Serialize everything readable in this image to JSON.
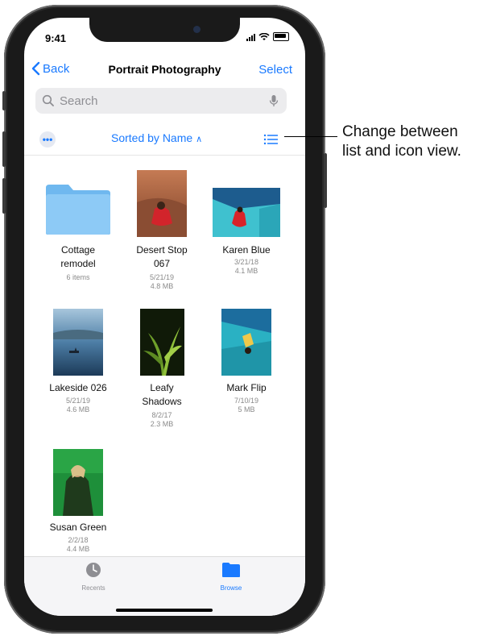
{
  "status_bar": {
    "time": "9:41"
  },
  "nav": {
    "back_label": "Back",
    "title": "Portrait Photography",
    "select_label": "Select"
  },
  "search": {
    "placeholder": "Search"
  },
  "toolbar": {
    "more_label": "•••",
    "sort_label": "Sorted by Name",
    "sort_caret": "∧"
  },
  "files": [
    {
      "name_line1": "Cottage",
      "name_line2": "remodel",
      "meta1": "6 items",
      "meta2": "",
      "kind": "folder"
    },
    {
      "name_line1": "Desert Stop",
      "name_line2": "067",
      "meta1": "5/21/19",
      "meta2": "4.8 MB",
      "kind": "photo"
    },
    {
      "name_line1": "Karen Blue",
      "name_line2": "",
      "meta1": "3/21/18",
      "meta2": "4.1 MB",
      "kind": "photo"
    },
    {
      "name_line1": "Lakeside 026",
      "name_line2": "",
      "meta1": "5/21/19",
      "meta2": "4.6 MB",
      "kind": "photo"
    },
    {
      "name_line1": "Leafy",
      "name_line2": "Shadows",
      "meta1": "8/2/17",
      "meta2": "2.3 MB",
      "kind": "photo"
    },
    {
      "name_line1": "Mark Flip",
      "name_line2": "",
      "meta1": "7/10/19",
      "meta2": "5 MB",
      "kind": "photo"
    },
    {
      "name_line1": "Susan Green",
      "name_line2": "",
      "meta1": "2/2/18",
      "meta2": "4.4 MB",
      "kind": "photo"
    }
  ],
  "tabs": [
    {
      "label": "Recents",
      "color": "#8e8e93"
    },
    {
      "label": "Browse",
      "color": "#1a7aff"
    }
  ],
  "callout": {
    "line1": "Change between",
    "line2": "list and icon view."
  },
  "colors": {
    "accent": "#1a7aff",
    "folder": "#7ec4f5"
  }
}
